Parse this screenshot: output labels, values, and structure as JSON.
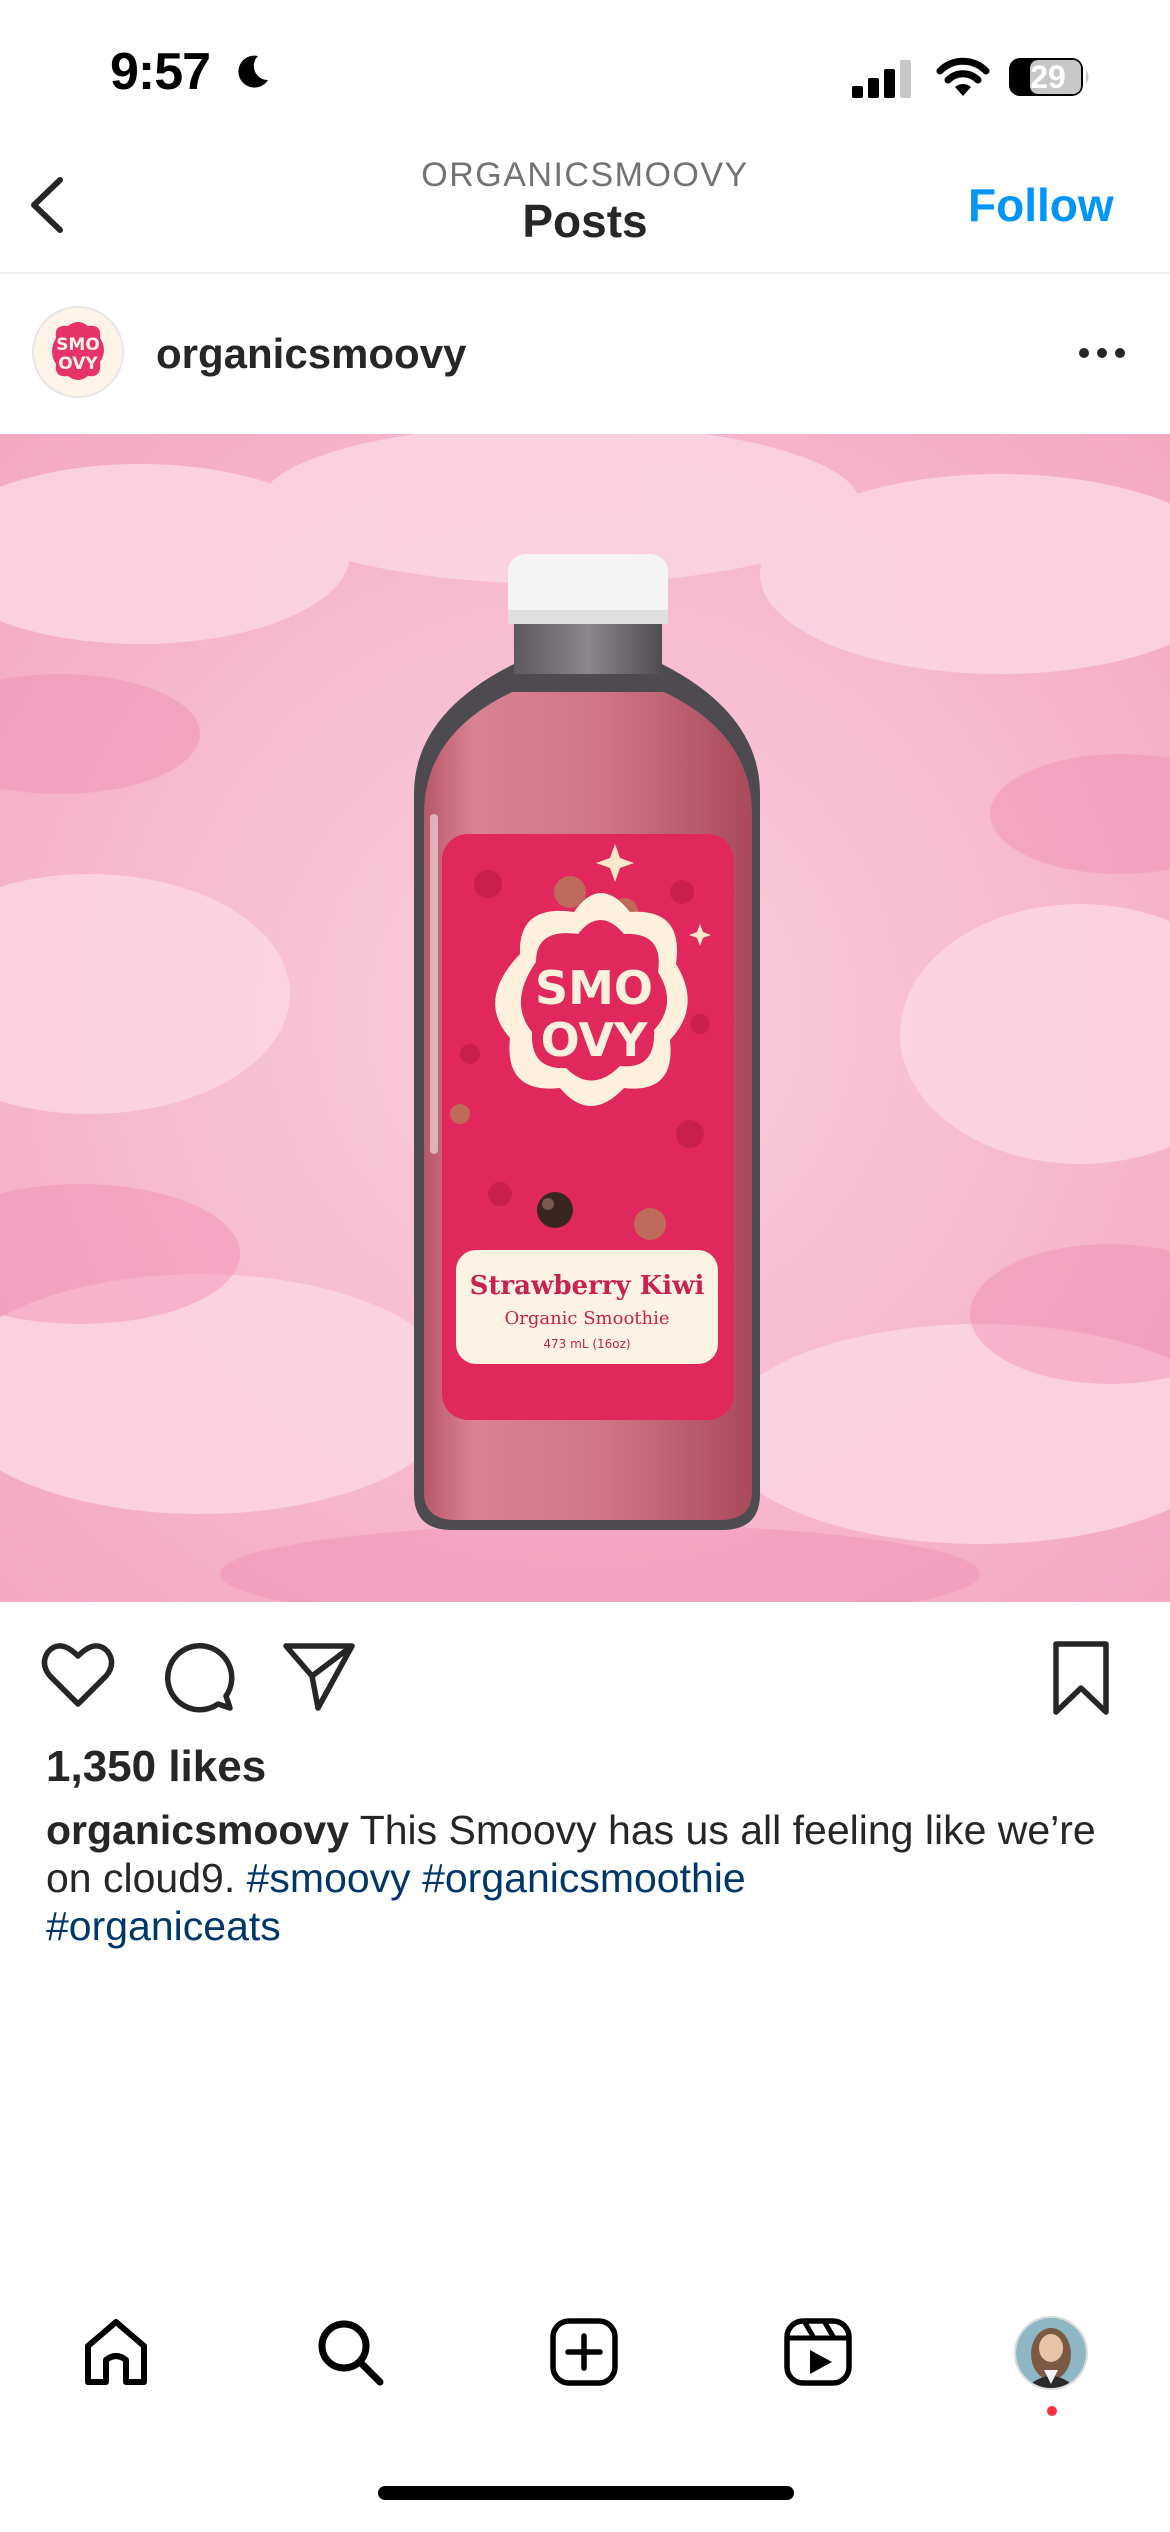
{
  "status_bar": {
    "time": "9:57",
    "battery": "29",
    "icons": [
      "moon-icon",
      "signal-icon",
      "wifi-icon",
      "battery-icon"
    ]
  },
  "header": {
    "subtitle": "ORGANICSMOOVY",
    "title": "Posts",
    "follow_label": "Follow",
    "back_icon": "chevron-left-icon"
  },
  "post": {
    "username": "organicsmoovy",
    "avatar_text": "SMOOVY",
    "more_icon": "ellipsis-icon",
    "image": {
      "brand": "SMOOVY",
      "flavor": "Strawberry Kiwi",
      "product": "Organic Smoothie",
      "volume": "473 mL (16oz)"
    },
    "likes": "1,350 likes",
    "caption": {
      "username": "organicsmoovy",
      "text": " This Smoovy has us all feeling like we’re on cloud9. ",
      "hashtags": [
        "#smoovy",
        "#organicsmoothie",
        "#organiceats"
      ]
    }
  },
  "tab_bar": {
    "items": [
      "home-icon",
      "search-icon",
      "create-icon",
      "reels-icon",
      "profile-avatar"
    ]
  },
  "colors": {
    "accent": "#0095f6",
    "hashtag": "#00376b",
    "cloud_pink": "#f6b8cd",
    "label_pink": "#e0285c",
    "notification": "#ff3040"
  }
}
